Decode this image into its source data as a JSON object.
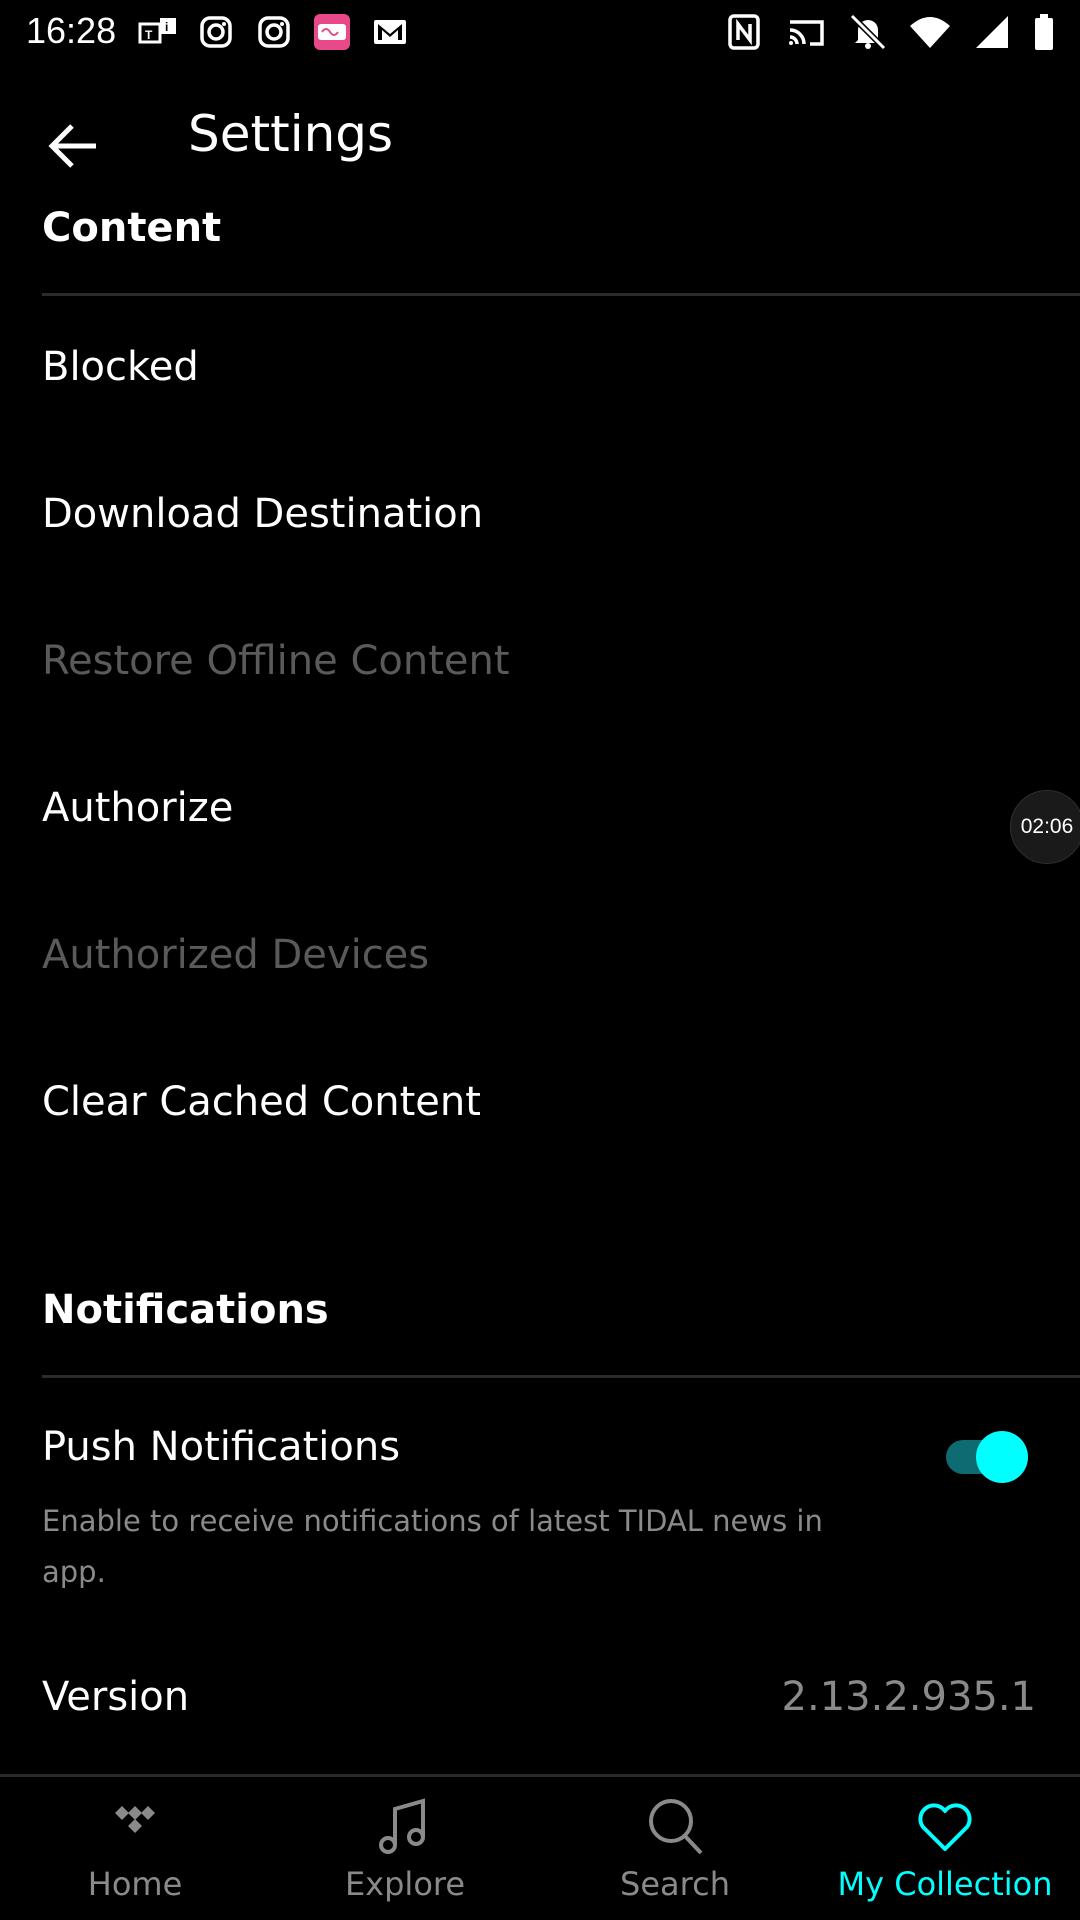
{
  "status_bar": {
    "time": "16:28",
    "left_icons": [
      "teams-notification-icon",
      "instagram-icon",
      "instagram-icon",
      "app-notification-icon",
      "gmail-icon"
    ],
    "right_icons": [
      "nfc-icon",
      "cast-icon",
      "bell-muted-icon",
      "wifi-icon",
      "signal-icon",
      "battery-icon"
    ]
  },
  "app_bar": {
    "title": "Settings",
    "back_icon": "arrow-left-icon"
  },
  "content_section": {
    "header": "Content",
    "items": [
      {
        "label": "Blocked",
        "enabled": true
      },
      {
        "label": "Download Destination",
        "enabled": true
      },
      {
        "label": "Restore Offline Content",
        "enabled": false
      },
      {
        "label": "Authorize",
        "enabled": true
      },
      {
        "label": "Authorized Devices",
        "enabled": false
      },
      {
        "label": "Clear Cached Content",
        "enabled": true
      }
    ]
  },
  "timer_badge": "02:06",
  "notifications_section": {
    "header": "Notifications",
    "push": {
      "label": "Push Notifications",
      "description": "Enable to receive notifications of latest TIDAL news in app.",
      "enabled": true
    }
  },
  "version": {
    "label": "Version",
    "value": "2.13.2.935.1"
  },
  "bottom_nav": {
    "items": [
      {
        "label": "Home",
        "icon": "tidal-logo-icon",
        "active": false
      },
      {
        "label": "Explore",
        "icon": "music-note-icon",
        "active": false
      },
      {
        "label": "Search",
        "icon": "search-icon",
        "active": false
      },
      {
        "label": "My Collection",
        "icon": "heart-icon",
        "active": true
      }
    ]
  },
  "colors": {
    "accent": "#00ffff",
    "background": "#000000",
    "text_primary": "#ffffff",
    "text_secondary": "#8a8a8a",
    "text_disabled": "#5a5a5a"
  }
}
